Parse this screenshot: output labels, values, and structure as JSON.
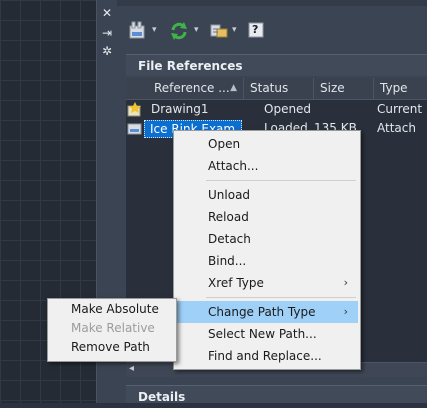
{
  "palette": {
    "file_references_header": "File References",
    "details_header": "Details",
    "columns": [
      "Reference ...",
      "Status",
      "Size",
      "Type"
    ],
    "rows": [
      {
        "name": "Drawing1",
        "status": "Opened",
        "size": "",
        "type": "Current"
      },
      {
        "name": "Ice Rink Exam",
        "status": "Loaded",
        "size": "135 KB",
        "type": "Attach"
      }
    ]
  },
  "context_menu": {
    "items": [
      "Open",
      "Attach...",
      "Unload",
      "Reload",
      "Detach",
      "Bind...",
      "Xref Type",
      "Change Path Type",
      "Select New Path...",
      "Find and Replace..."
    ]
  },
  "submenu": {
    "items": [
      "Make Absolute",
      "Make Relative",
      "Remove Path"
    ]
  },
  "icons": {
    "close": "✕",
    "pin": "⇥",
    "settings": "✲",
    "submenu_arrow": "›",
    "sort_arrow": "▲",
    "caret": "▾",
    "help": "?"
  },
  "colors": {
    "highlight": "#9fd0f7",
    "selection": "#0a6fd0",
    "panel": "#3b4453"
  }
}
